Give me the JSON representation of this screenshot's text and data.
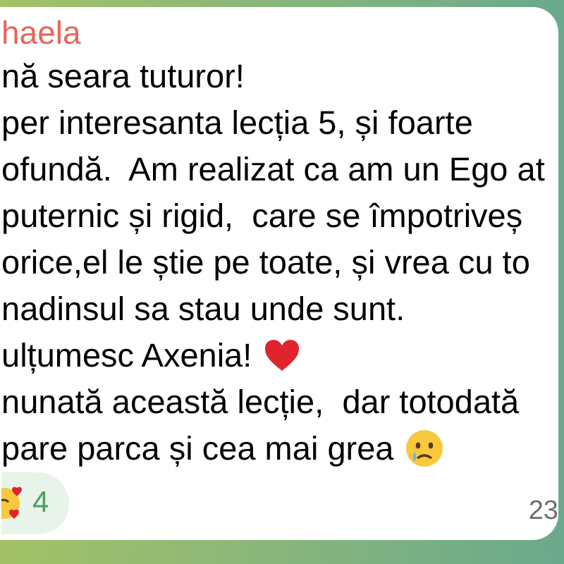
{
  "message": {
    "sender": "haela",
    "lines": [
      {
        "text": "nă seara tuturor!",
        "kind": "text"
      },
      {
        "text": "per interesanta lecția 5, și foarte",
        "kind": "text"
      },
      {
        "text": "ofundă.  Am realizat ca am un Ego at",
        "kind": "text"
      },
      {
        "text": "puternic și rigid,  care se împotriveș",
        "kind": "text"
      },
      {
        "text": "orice,el le știe pe toate, și vrea cu to",
        "kind": "text"
      },
      {
        "text": "nadinsul sa stau unde sunt.",
        "kind": "text"
      },
      {
        "text": "ulțumesc Axenia!",
        "kind": "heart"
      },
      {
        "text": "nunată această lecție,  dar totodată",
        "kind": "text"
      },
      {
        "text": "pare parca și cea mai grea",
        "kind": "cry"
      }
    ],
    "reaction": {
      "count": "4"
    },
    "time": "23"
  }
}
